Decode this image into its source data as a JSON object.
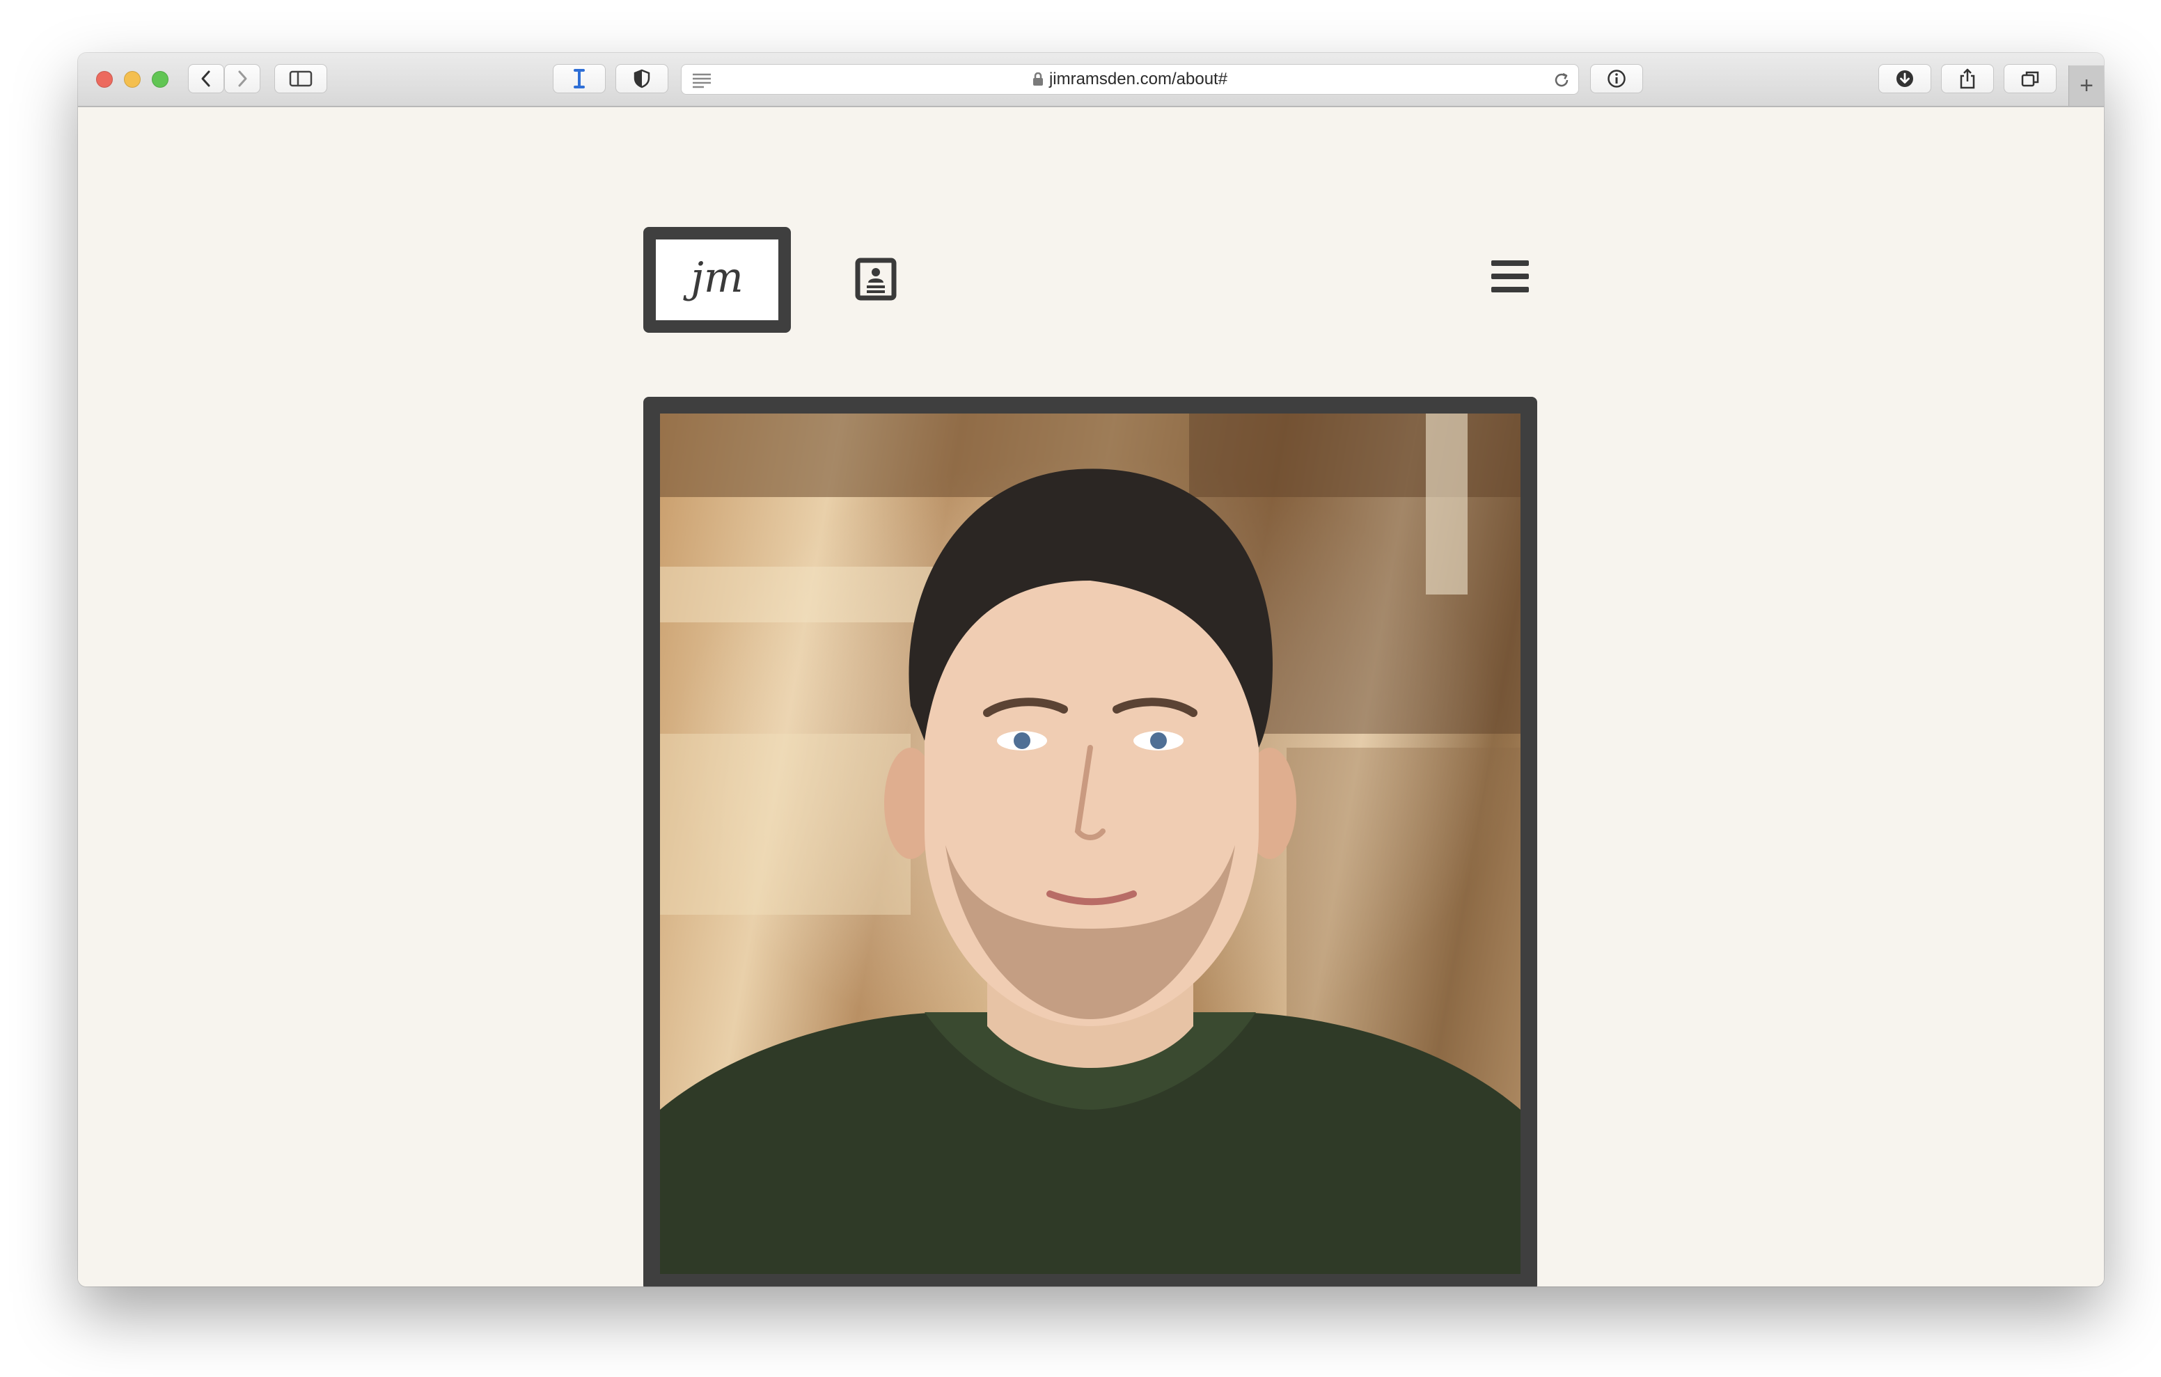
{
  "browser": {
    "url": "jimramsden.com/about#",
    "new_tab_label": "+"
  },
  "site": {
    "logo_text": "jm",
    "photo_alt": "Portrait of Jim Ramsden"
  },
  "colors": {
    "page_background": "#f7f4ee",
    "frame": "#3f3f3f",
    "accent_blue": "#2f6fd6"
  },
  "icons": {
    "contact": "contact-card-icon",
    "menu": "hamburger-menu-icon"
  }
}
